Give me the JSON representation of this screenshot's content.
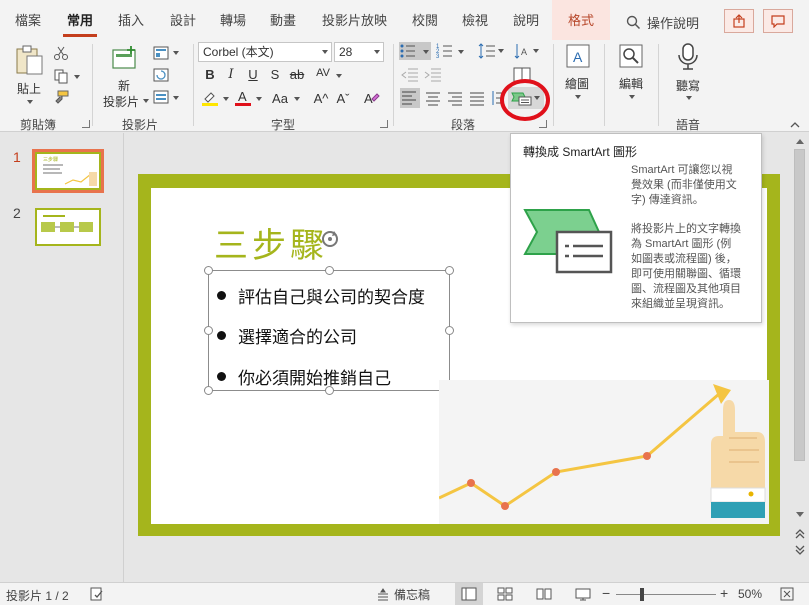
{
  "tabs": [
    "檔案",
    "常用",
    "插入",
    "設計",
    "轉場",
    "動畫",
    "投影片放映",
    "校閱",
    "檢視",
    "說明",
    "格式"
  ],
  "active_tab": "常用",
  "search": {
    "label": "操作說明"
  },
  "ribbon": {
    "clipboard": {
      "paste_label": "貼上",
      "group_label": "剪貼簿"
    },
    "slides": {
      "new_slide_line1": "新",
      "new_slide_line2": "投影片",
      "group_label": "投影片"
    },
    "font": {
      "font_name": "Corbel (本文)",
      "font_size": "28",
      "bold": "B",
      "italic": "I",
      "underline": "U",
      "shadow": "S",
      "strike": "ab",
      "spacing": "AV",
      "size_up": "A^",
      "size_down": "Aˇ",
      "case": "Aa",
      "group_label": "字型"
    },
    "paragraph": {
      "group_label": "段落"
    },
    "drawing": {
      "label": "繪圖"
    },
    "editing": {
      "label": "編輯"
    },
    "voice": {
      "label": "聽寫",
      "group_label": "語音"
    }
  },
  "colors": {
    "accent": "#c43e1c",
    "slide_border": "#a5b51c",
    "highlight_circle": "#e0101a",
    "smartart_green": "#2ea24a"
  },
  "slides": [
    {
      "number": "1",
      "active": true
    },
    {
      "number": "2",
      "active": false
    }
  ],
  "slide": {
    "title": "三步驟",
    "bullets": [
      "評估自己與公司的契合度",
      "選擇適合的公司",
      "你必須開始推銷自己"
    ]
  },
  "tooltip": {
    "title": "轉換成 SmartArt 圖形",
    "para1": [
      "SmartArt 可讓您以視",
      "覺效果 (而非僅使用文",
      "字) 傳達資訊。"
    ],
    "para2": [
      "將投影片上的文字轉換",
      "為 SmartArt 圖形 (例",
      "如圖表或流程圖) 後，",
      "即可使用關聯圖、循環",
      "圖、流程圖及其他項目",
      "來組織並呈現資訊。"
    ]
  },
  "statusbar": {
    "slide_info": "投影片 1 / 2",
    "notes": "備忘稿",
    "zoom": "50%"
  },
  "icons": [
    "search-icon",
    "share-icon",
    "comment-icon",
    "paste-icon",
    "cut-icon",
    "copy-icon",
    "format-painter-icon",
    "new-slide-icon",
    "layout-icon",
    "reset-icon",
    "section-icon",
    "smartart-convert-icon",
    "drawing-icon",
    "editing-icon",
    "microphone-icon"
  ]
}
